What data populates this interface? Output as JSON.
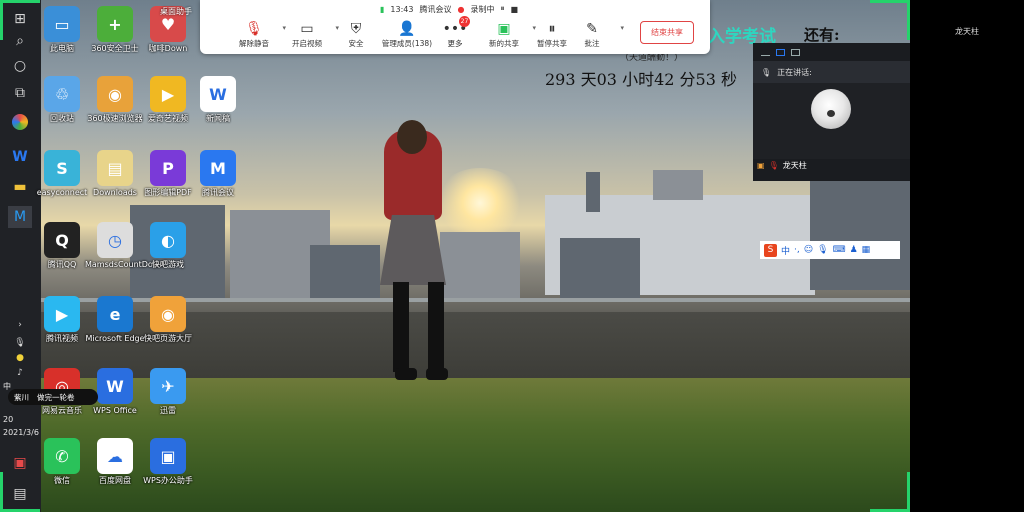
{
  "meeting": {
    "time": "13:43",
    "app_name": "腾讯会议",
    "recording_label": "录制中",
    "toolbar": [
      {
        "id": "unmute",
        "label": "解除静音",
        "icon": "mic-off-icon"
      },
      {
        "id": "start-video",
        "label": "开启视频",
        "icon": "video-off-icon"
      },
      {
        "id": "security",
        "label": "安全",
        "icon": "shield-icon"
      },
      {
        "id": "members",
        "label": "管理成员(138)",
        "icon": "members-icon"
      },
      {
        "id": "more",
        "label": "更多",
        "icon": "more-icon",
        "badge": "27"
      },
      {
        "id": "new-share",
        "label": "新的共享",
        "icon": "screen-share-icon"
      },
      {
        "id": "pause-share",
        "label": "暂停共享",
        "icon": "pause-share-icon"
      },
      {
        "id": "annotate",
        "label": "批注",
        "icon": "annotate-icon"
      }
    ],
    "end_share_label": "结束共享",
    "speaker": {
      "speaking_label": "正在讲话:",
      "name": "龙天柱"
    },
    "right_name": "龙天柱"
  },
  "overlay": {
    "exam_title": "入学考试",
    "exam_suffix": "还有:",
    "motto": "（天道酬勤！）",
    "countdown": "293 天03 小时42 分53 秒"
  },
  "desktop": {
    "assistant_label": "桌面助手",
    "icons": [
      {
        "label": "此电脑",
        "color": "#3a8fd8",
        "glyph": "▭"
      },
      {
        "label": "360安全卫士",
        "color": "#4cae3a",
        "glyph": "+"
      },
      {
        "label": "咖啡Down",
        "color": "#d84a4a",
        "glyph": "♥"
      },
      {
        "label": "回收站",
        "color": "#5aa6e8",
        "glyph": "♲"
      },
      {
        "label": "360极速浏览器",
        "color": "#e8a23a",
        "glyph": "◉"
      },
      {
        "label": "爱奇艺视频",
        "color": "#f0b822",
        "glyph": "▶"
      },
      {
        "label": "新闻稿",
        "color": "#ffffff",
        "glyph": "W"
      },
      {
        "label": "easyconnect",
        "color": "#39b3d8",
        "glyph": "S"
      },
      {
        "label": "Downloads",
        "color": "#e8d48a",
        "glyph": "▤"
      },
      {
        "label": "图形编辑PDF",
        "color": "#7a3ad8",
        "glyph": "P"
      },
      {
        "label": "腾讯会议",
        "color": "#2a78f0",
        "glyph": "M"
      },
      {
        "label": "腾讯QQ",
        "color": "#222222",
        "glyph": "Q"
      },
      {
        "label": "MamsdsCountDown",
        "color": "#dddddd",
        "glyph": "◷"
      },
      {
        "label": "快吧游戏",
        "color": "#2aa0e8",
        "glyph": "◐"
      },
      {
        "label": "腾讯视频",
        "color": "#2ab8f0",
        "glyph": "▶"
      },
      {
        "label": "Microsoft Edge",
        "color": "#1a78d0",
        "glyph": "e"
      },
      {
        "label": "快吧页游大厅",
        "color": "#f0a23a",
        "glyph": "◉"
      },
      {
        "label": "网易云音乐",
        "color": "#d8302a",
        "glyph": "◎"
      },
      {
        "label": "WPS Office",
        "color": "#2a6ee0",
        "glyph": "W"
      },
      {
        "label": "迅雷",
        "color": "#3a9af0",
        "glyph": "✈"
      },
      {
        "label": "微信",
        "color": "#2ac25a",
        "glyph": "✆"
      },
      {
        "label": "百度网盘",
        "color": "#ffffff",
        "glyph": "☁"
      },
      {
        "label": "WPS办公助手",
        "color": "#2a6ee0",
        "glyph": "▣"
      }
    ],
    "notify": {
      "a": "紫川",
      "b": "做完一轮卷"
    }
  },
  "taskbar": {
    "clock_time": "20",
    "clock_date": "2021/3/6",
    "ime_char": "中"
  },
  "ime_bar": {
    "logo": "S",
    "text": "中"
  }
}
